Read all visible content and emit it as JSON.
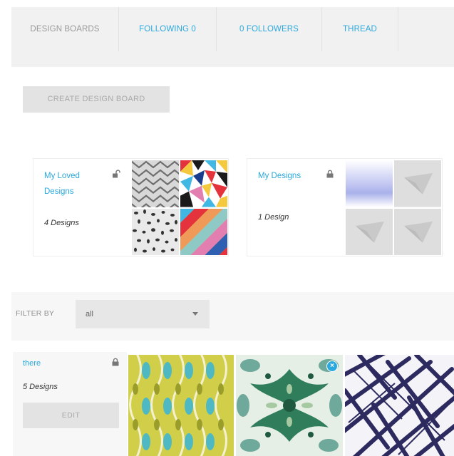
{
  "tabs": [
    {
      "label": "DESIGN BOARDS"
    },
    {
      "label": "FOLLOWING 0"
    },
    {
      "label": "0 FOLLOWERS"
    },
    {
      "label": "THREAD"
    }
  ],
  "create_button": "CREATE DESIGN BOARD",
  "boards": [
    {
      "title": "My Loved Designs",
      "count": "4 Designs",
      "lock_icon": "lock-open-icon"
    },
    {
      "title": "My Designs",
      "count": "1 Design",
      "lock_icon": "lock-icon"
    }
  ],
  "filter": {
    "label": "FILTER BY",
    "value": "all"
  },
  "bottom_board": {
    "title": "there",
    "count": "5 Designs",
    "edit_label": "EDIT",
    "remove_glyph": "×"
  },
  "colors": {
    "accent": "#29a9df",
    "tab_bg": "#f1f1f1",
    "button_bg": "#e3e3e3"
  }
}
